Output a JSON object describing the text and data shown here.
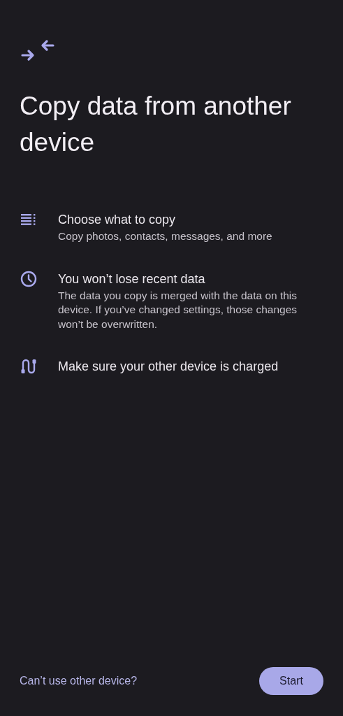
{
  "header": {
    "title": "Copy data from another device"
  },
  "items": [
    {
      "kind": "list",
      "title": "Choose what to copy",
      "description": "Copy photos, contacts, messages, and more"
    },
    {
      "kind": "clock",
      "title": "You won’t lose recent data",
      "description": "The data you copy is merged with the data on this device. If you’ve changed settings, those changes won’t be overwritten."
    },
    {
      "kind": "cable",
      "title": "Make sure your other device is charged"
    }
  ],
  "footer": {
    "link": "Can’t use other device?",
    "button": "Start"
  }
}
